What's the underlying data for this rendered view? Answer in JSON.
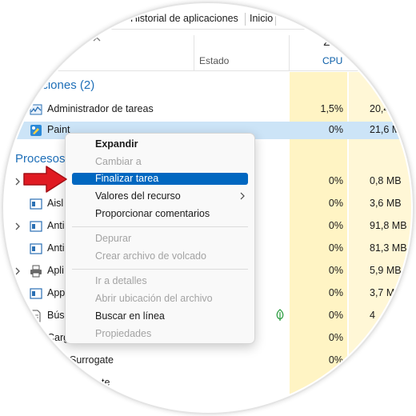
{
  "tabs": [
    "Historial de aplicaciones",
    "Inicio"
  ],
  "header": {
    "status_label": "Estado",
    "cpu_pct_partial": "2",
    "cpu_label": "CPU"
  },
  "sections": {
    "apps": "aciones (2)",
    "processes": "Procesos"
  },
  "rows": [
    {
      "name": "Administrador de tareas",
      "cpu": "1,5%",
      "mem": "20,4",
      "icon": "task-manager-icon"
    },
    {
      "name": "Paint",
      "cpu": "0%",
      "mem": "21,6 M",
      "icon": "paint-icon"
    },
    {
      "name": "",
      "cpu": "0%",
      "mem": "0,8 MB",
      "icon": "app-icon"
    },
    {
      "name": "Aisl",
      "cpu": "0%",
      "mem": "3,6 MB",
      "icon": "app-icon"
    },
    {
      "name": "Anti",
      "cpu": "0%",
      "mem": "91,8 MB",
      "icon": "app-icon"
    },
    {
      "name": "Anti",
      "cpu": "0%",
      "mem": "81,3 MB",
      "icon": "app-icon"
    },
    {
      "name": "Apli",
      "cpu": "0%",
      "mem": "5,9 MB",
      "icon": "printer-icon"
    },
    {
      "name": "App",
      "cpu": "0%",
      "mem": "3,7 M",
      "icon": "app-icon"
    },
    {
      "name": "Bús",
      "cpu": "0%",
      "mem": "4",
      "icon": "search-app-icon"
    },
    {
      "name": "Carg",
      "cpu": "0%",
      "mem": "",
      "icon": "app-icon"
    },
    {
      "name": "Surrogate",
      "cpu": "0%",
      "mem": "",
      "icon": "app-icon"
    },
    {
      "name": "te",
      "cpu": "",
      "mem": "",
      "icon": "app-icon"
    }
  ],
  "menu": {
    "items": [
      {
        "label": "Expandir",
        "enabled": true,
        "bold": true
      },
      {
        "label": "Cambiar a",
        "enabled": false
      },
      {
        "label": "Finalizar tarea",
        "enabled": true,
        "highlighted": true
      },
      {
        "label": "Valores del recurso",
        "enabled": true,
        "submenu": true
      },
      {
        "label": "Proporcionar comentarios",
        "enabled": true
      },
      {
        "label": "Depurar",
        "enabled": false
      },
      {
        "label": "Crear archivo de volcado",
        "enabled": false
      },
      {
        "label": "Ir a detalles",
        "enabled": false
      },
      {
        "label": "Abrir ubicación del archivo",
        "enabled": false
      },
      {
        "label": "Buscar en línea",
        "enabled": true
      },
      {
        "label": "Propiedades",
        "enabled": false
      }
    ]
  },
  "colors": {
    "accent": "#0067c0",
    "section_blue": "#1e6fb8",
    "selection": "#cce4f7",
    "heat_yellow": "#fff4c4",
    "arrow_red": "#e01a22"
  }
}
